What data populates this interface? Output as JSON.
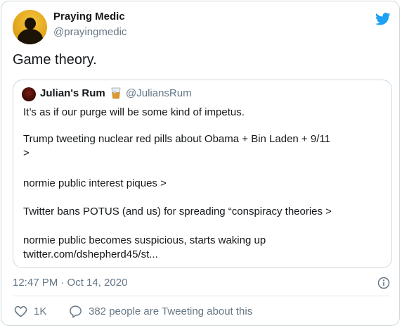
{
  "author": {
    "name": "Praying Medic",
    "handle": "@prayingmedic"
  },
  "tweet": {
    "text": "Game theory."
  },
  "quoted": {
    "name": "Julian's Rum",
    "handle": "@JuliansRum",
    "lines": [
      "It’s as if our purge will be some kind of impetus.",
      "Trump tweeting nuclear red pills about Obama + Bin Laden + 9/11",
      ">",
      "normie public interest piques >",
      "Twitter bans POTUS (and us) for spreading “conspiracy theories >",
      "normie public becomes suspicious, starts waking up",
      "twitter.com/dshepherd45/st..."
    ]
  },
  "timestamp": "12:47 PM · Oct 14, 2020",
  "actions": {
    "likes": "1K",
    "conversation": "382 people are Tweeting about this"
  },
  "icons": {
    "brand": "twitter-bird-icon",
    "info": "info-icon",
    "like": "heart-icon",
    "reply": "comment-icon",
    "emoji": "tumbler-glass-emoji"
  },
  "colors": {
    "brand": "#1da1f2",
    "secondary_text": "#657786",
    "border": "#cfd9de"
  }
}
